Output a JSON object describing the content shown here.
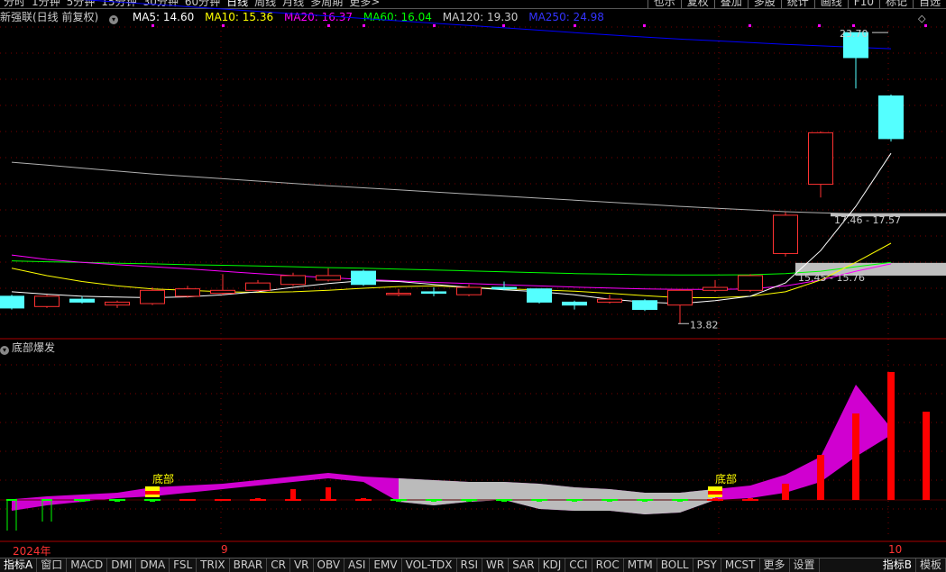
{
  "top_tabs": [
    "分时",
    "1分钟",
    "5分钟",
    "15分钟",
    "30分钟",
    "60分钟",
    "日线",
    "周线",
    "月线",
    "多周期",
    "更多>"
  ],
  "top_active": "日线",
  "top_right_buttons": [
    "也示",
    "复权",
    "叠加",
    "多股",
    "统计",
    "画线",
    "F10",
    "标记",
    "自选"
  ],
  "legend": {
    "title": "新强联(日线 前复权)",
    "ma5": "MA5: 14.60",
    "ma10": "MA10: 15.36",
    "ma20": "MA20: 16.37",
    "ma60": "MA60: 16.04",
    "ma120": "MA120: 19.30",
    "ma250": "MA250: 24.98"
  },
  "colors": {
    "up": "#ff3232",
    "down": "#54ffff",
    "ma5": "#ffffff",
    "ma10": "#ffff00",
    "ma20": "#ff00ff",
    "ma60": "#00ff00",
    "ma120": "#b0b0b0",
    "ma250": "#0000ff",
    "bar": "#ff0000",
    "area": "#d000d0",
    "signal": "#ffff00"
  },
  "price_labels": {
    "high": "23.70",
    "low": "13.82",
    "zone_upper": "17.46 - 17.57",
    "zone_lower": "15.45 - 15.76"
  },
  "indicator_title": "底部爆发",
  "signal_label": "底部",
  "date_axis": {
    "start": "2024年",
    "mid": "9",
    "end": "10"
  },
  "bottom_tabs": [
    "指标A",
    "窗口",
    "MACD",
    "DMI",
    "DMA",
    "FSL",
    "TRIX",
    "BRAR",
    "CR",
    "VR",
    "OBV",
    "ASI",
    "EMV",
    "VOL-TDX",
    "RSI",
    "WR",
    "SAR",
    "KDJ",
    "CCI",
    "ROC",
    "MTM",
    "BOLL",
    "PSY",
    "MCST",
    "更多",
    "设置"
  ],
  "bottom_right_tabs": [
    "指标B",
    "模板"
  ],
  "chart_data": {
    "type": "candlestick",
    "candles": [
      {
        "o": 14.75,
        "c": 14.35,
        "h": 14.8,
        "l": 14.3
      },
      {
        "o": 14.4,
        "c": 14.75,
        "h": 14.8,
        "l": 14.35
      },
      {
        "o": 14.65,
        "c": 14.55,
        "h": 14.75,
        "l": 14.5
      },
      {
        "o": 14.45,
        "c": 14.55,
        "h": 14.6,
        "l": 14.35
      },
      {
        "o": 14.5,
        "c": 14.95,
        "h": 15.05,
        "l": 14.45
      },
      {
        "o": 14.75,
        "c": 15.0,
        "h": 15.1,
        "l": 14.7
      },
      {
        "o": 14.85,
        "c": 14.95,
        "h": 15.5,
        "l": 14.8
      },
      {
        "o": 14.95,
        "c": 15.2,
        "h": 15.3,
        "l": 14.9
      },
      {
        "o": 15.15,
        "c": 15.45,
        "h": 15.55,
        "l": 15.1
      },
      {
        "o": 15.3,
        "c": 15.45,
        "h": 15.7,
        "l": 15.25
      },
      {
        "o": 15.6,
        "c": 15.15,
        "h": 15.65,
        "l": 15.1
      },
      {
        "o": 14.85,
        "c": 14.85,
        "h": 15.0,
        "l": 14.75
      },
      {
        "o": 14.9,
        "c": 14.85,
        "h": 15.05,
        "l": 14.75
      },
      {
        "o": 14.8,
        "c": 15.05,
        "h": 15.15,
        "l": 14.75
      },
      {
        "o": 15.05,
        "c": 15.0,
        "h": 15.25,
        "l": 14.95
      },
      {
        "o": 15.0,
        "c": 14.55,
        "h": 15.0,
        "l": 14.5
      },
      {
        "o": 14.55,
        "c": 14.45,
        "h": 14.6,
        "l": 14.3
      },
      {
        "o": 14.55,
        "c": 14.65,
        "h": 14.8,
        "l": 14.5
      },
      {
        "o": 14.6,
        "c": 14.3,
        "h": 14.65,
        "l": 14.25
      },
      {
        "o": 14.45,
        "c": 14.95,
        "h": 15.0,
        "l": 13.82
      },
      {
        "o": 14.95,
        "c": 15.05,
        "h": 15.3,
        "l": 14.9
      },
      {
        "o": 14.95,
        "c": 15.45,
        "h": 15.5,
        "l": 14.9
      },
      {
        "o": 16.2,
        "c": 17.5,
        "h": 17.6,
        "l": 16.1
      },
      {
        "o": 18.55,
        "c": 20.3,
        "h": 20.35,
        "l": 18.1
      },
      {
        "o": 23.7,
        "c": 22.85,
        "h": 23.7,
        "l": 21.8
      },
      {
        "o": 21.55,
        "c": 20.1,
        "h": 21.6,
        "l": 20.0
      }
    ],
    "ma": {
      "ma5": [
        14.9,
        14.82,
        14.75,
        14.72,
        14.7,
        14.73,
        14.8,
        14.9,
        15.05,
        15.18,
        15.28,
        15.25,
        15.15,
        15.05,
        14.97,
        14.9,
        14.8,
        14.65,
        14.55,
        14.5,
        14.6,
        14.75,
        15.2,
        16.3,
        17.8,
        19.6
      ],
      "ma10": [
        15.7,
        15.45,
        15.25,
        15.1,
        15.0,
        14.95,
        14.9,
        14.88,
        14.9,
        14.95,
        15.02,
        15.08,
        15.1,
        15.05,
        15.0,
        14.97,
        14.92,
        14.85,
        14.77,
        14.7,
        14.7,
        14.75,
        14.9,
        15.3,
        15.9,
        16.55
      ],
      "ma20": [
        16.15,
        16.0,
        15.9,
        15.82,
        15.75,
        15.68,
        15.6,
        15.52,
        15.45,
        15.38,
        15.32,
        15.27,
        15.22,
        15.18,
        15.14,
        15.1,
        15.06,
        15.03,
        15.0,
        14.98,
        14.98,
        15.0,
        15.1,
        15.3,
        15.6,
        15.85
      ],
      "ma60": [
        15.95,
        15.92,
        15.9,
        15.87,
        15.85,
        15.82,
        15.8,
        15.78,
        15.75,
        15.72,
        15.7,
        15.67,
        15.64,
        15.61,
        15.58,
        15.55,
        15.52,
        15.5,
        15.48,
        15.47,
        15.47,
        15.48,
        15.52,
        15.6,
        15.75,
        15.9
      ],
      "ma120": [
        19.3,
        19.2,
        19.1,
        19.0,
        18.9,
        18.82,
        18.74,
        18.66,
        18.58,
        18.5,
        18.43,
        18.36,
        18.29,
        18.22,
        18.15,
        18.08,
        18.01,
        17.94,
        17.87,
        17.8,
        17.74,
        17.68,
        17.62,
        17.58,
        17.55,
        17.52
      ],
      "ma250": [
        24.98,
        24.9,
        24.82,
        24.74,
        24.66,
        24.58,
        24.5,
        24.42,
        24.34,
        24.26,
        24.18,
        24.1,
        24.02,
        23.94,
        23.86,
        23.78,
        23.7,
        23.62,
        23.55,
        23.48,
        23.42,
        23.36,
        23.3,
        23.25,
        23.2,
        23.15
      ]
    },
    "price_range": [
      13.4,
      24.5
    ],
    "indicator": {
      "area_upper": [
        0.2,
        1.0,
        1.5,
        2.0,
        3.5,
        4.0,
        4.5,
        5.5,
        6.5,
        7.5,
        6.5,
        6.0,
        5.5,
        5.0,
        5.0,
        4.5,
        3.5,
        3.0,
        2.0,
        2.0,
        3.0,
        4.0,
        7.0,
        12.0,
        32.0,
        20.0
      ],
      "area_lower": [
        -3.0,
        -1.5,
        -0.5,
        0.5,
        1.0,
        2.0,
        3.0,
        4.0,
        5.0,
        6.0,
        5.0,
        -0.5,
        -1.5,
        -0.5,
        0.0,
        -2.5,
        -3.0,
        -3.0,
        -4.0,
        -3.5,
        0.0,
        0.5,
        2.0,
        5.0,
        12.0,
        18.0
      ],
      "bars": [
        -8.5,
        -6.0,
        -0.5,
        -0.5,
        -0.5,
        0.2,
        0.2,
        0.5,
        3.0,
        3.5,
        0.5,
        -0.5,
        -0.5,
        -0.5,
        -0.5,
        -0.5,
        -0.5,
        -0.5,
        -0.5,
        -0.5,
        0.5,
        0.5,
        4.5,
        12.5,
        24.0,
        35.5,
        24.5
      ],
      "signals": [
        4,
        20
      ],
      "range": [
        -10,
        40
      ]
    }
  }
}
